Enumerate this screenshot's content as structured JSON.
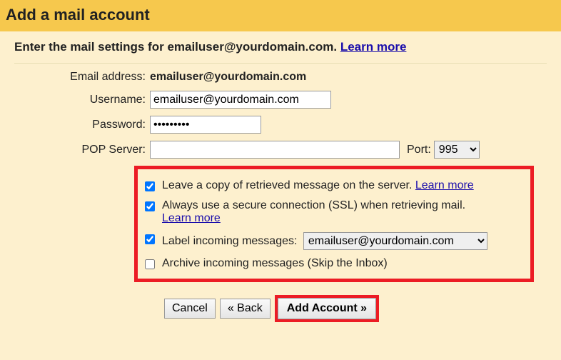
{
  "title": "Add a mail account",
  "headerPrefix": "Enter the mail settings for ",
  "headerEmail": "emailuser@yourdomain.com",
  "headerSuffix": ". ",
  "learnMore": "Learn more",
  "labels": {
    "emailAddress": "Email address:",
    "username": "Username:",
    "password": "Password:",
    "popServer": "POP Server:",
    "port": "Port:"
  },
  "values": {
    "emailAddress": "emailuser@yourdomain.com",
    "username": "emailuser@yourdomain.com",
    "password": "•••••••••",
    "popServer": "",
    "port": "995"
  },
  "options": {
    "leaveCopy": "Leave a copy of retrieved message on the server. ",
    "ssl": "Always use a secure connection (SSL) when retrieving mail. ",
    "labelIncoming": "Label incoming messages: ",
    "labelIncomingValue": "emailuser@yourdomain.com",
    "archive": "Archive incoming messages (Skip the Inbox)"
  },
  "buttons": {
    "cancel": "Cancel",
    "back": "« Back",
    "addAccount": "Add Account »"
  }
}
